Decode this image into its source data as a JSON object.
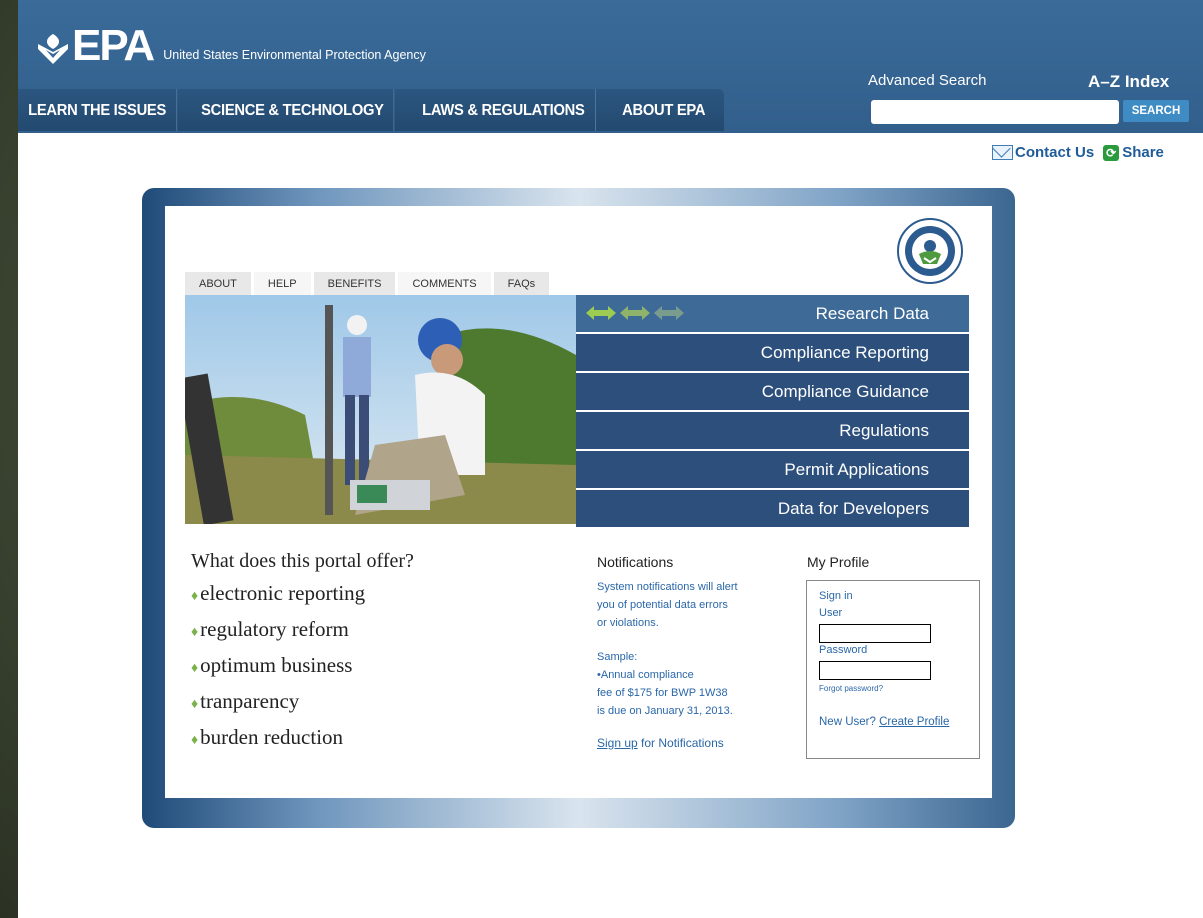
{
  "brand": {
    "name": "EPA",
    "agency": "United States Environmental Protection Agency"
  },
  "topnav": [
    "LEARN THE ISSUES",
    "SCIENCE & TECHNOLOGY",
    "LAWS & REGULATIONS",
    "ABOUT EPA"
  ],
  "search": {
    "advanced_label": "Advanced Search",
    "az_label": "A–Z Index",
    "button_label": "SEARCH",
    "value": ""
  },
  "utility": {
    "contact_label": "Contact Us",
    "share_label": "Share"
  },
  "portal": {
    "subtabs": [
      "ABOUT",
      "HELP",
      "BENEFITS",
      "COMMENTS",
      "FAQs"
    ],
    "menu": [
      "Research Data",
      "Compliance Reporting",
      "Compliance Guidance",
      "Regulations",
      "Permit Applications",
      "Data for Developers"
    ],
    "offer": {
      "title": "What does this portal offer?",
      "items": [
        "electronic reporting",
        "regulatory reform",
        "optimum business",
        "tranparency",
        "burden reduction"
      ]
    },
    "notifications": {
      "title": "Notifications",
      "line1": "System notifications will alert",
      "line2": "you of potential data errors",
      "line3": "or violations.",
      "sample_label": "Sample:",
      "sample1": "•Annual compliance",
      "sample2": "fee of $175 for BWP 1W38",
      "sample3": "is due on January 31, 2013.",
      "signup_link": "Sign up",
      "signup_rest": " for Notifications"
    },
    "profile": {
      "title": "My Profile",
      "sign_in": "Sign in",
      "user_label": "User",
      "password_label": "Password",
      "forgot": "Forgot password?",
      "new_user": "New User? ",
      "create_link": "Create Profile",
      "user_value": "",
      "password_value": ""
    }
  },
  "colors": {
    "masthead": "#3a6b99",
    "menu": "#2c4f7c",
    "accent_green": "#7bb04a",
    "link": "#2a67a8"
  },
  "icons": [
    "epa-flower-icon",
    "envelope-icon",
    "share-icon",
    "double-arrow-icon",
    "epa-seal-icon"
  ]
}
